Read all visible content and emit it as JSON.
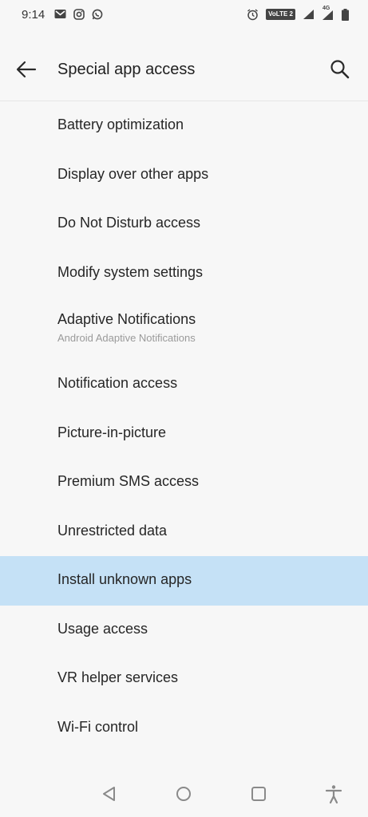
{
  "status_bar": {
    "time": "9:14",
    "left_icons": [
      "gmail-icon",
      "instagram-icon",
      "whatsapp-icon"
    ],
    "volte_label": "VoLTE 2",
    "network_label": "4G",
    "right_icons": [
      "alarm-icon",
      "volte-icon",
      "signal-icon",
      "signal-4g-icon",
      "battery-icon"
    ]
  },
  "app_bar": {
    "title": "Special app access",
    "back_icon": "arrow-back-icon",
    "search_icon": "search-icon"
  },
  "items": [
    {
      "title": "Battery optimization"
    },
    {
      "title": "Display over other apps"
    },
    {
      "title": "Do Not Disturb access"
    },
    {
      "title": "Modify system settings"
    },
    {
      "title": "Adaptive Notifications",
      "subtitle": "Android Adaptive Notifications"
    },
    {
      "title": "Notification access"
    },
    {
      "title": "Picture-in-picture"
    },
    {
      "title": "Premium SMS access"
    },
    {
      "title": "Unrestricted data"
    },
    {
      "title": "Install unknown apps",
      "highlighted": true
    },
    {
      "title": "Usage access"
    },
    {
      "title": "VR helper services"
    },
    {
      "title": "Wi-Fi control"
    }
  ],
  "nav_bar": {
    "icons": [
      "nav-back-icon",
      "nav-home-icon",
      "nav-recents-icon",
      "accessibility-icon"
    ]
  },
  "colors": {
    "background": "#f7f7f7",
    "highlight": "#c5e1f6",
    "text_primary": "#262626",
    "text_secondary": "#9a9a9a"
  }
}
